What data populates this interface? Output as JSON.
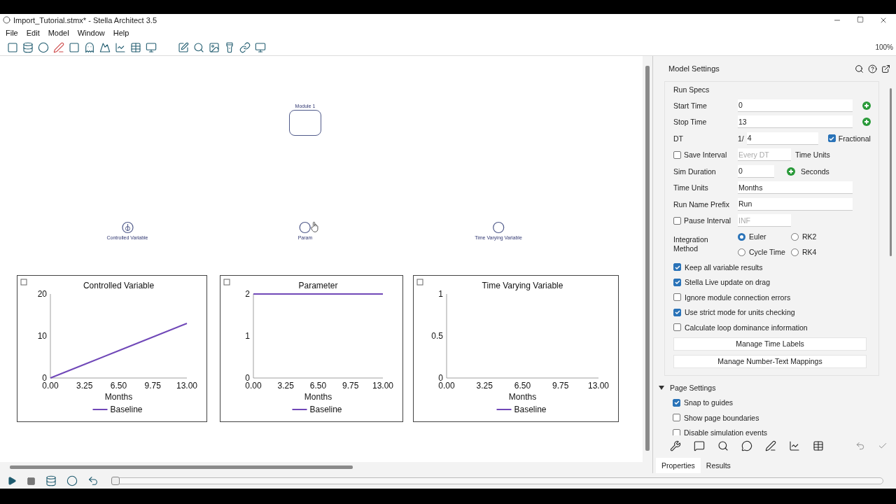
{
  "window": {
    "title": "Import_Tutorial.stmx* - Stella Architect 3.5"
  },
  "menu": [
    "File",
    "Edit",
    "Model",
    "Window",
    "Help"
  ],
  "toolbar": {
    "zoom": "100%"
  },
  "canvas": {
    "module": {
      "label": "Module 1"
    },
    "variables": [
      {
        "label": "Controlled Variable",
        "kind": "controlled"
      },
      {
        "label": "Param",
        "kind": "converter"
      },
      {
        "label": "Time Varying Variable",
        "kind": "converter"
      }
    ],
    "charts": [
      {
        "chart_data": {
          "type": "line",
          "title": "Controlled Variable",
          "xlabel": "Months",
          "categories": [
            "0.00",
            "3.25",
            "6.50",
            "9.75",
            "13.00"
          ],
          "ylim": [
            0,
            20
          ],
          "yticks": [
            0,
            10,
            20
          ],
          "series": [
            {
              "name": "Baseline",
              "color": "#7048b8",
              "values": [
                0,
                3.25,
                6.5,
                9.75,
                13
              ]
            }
          ]
        }
      },
      {
        "chart_data": {
          "type": "line",
          "title": "Parameter",
          "xlabel": "Months",
          "categories": [
            "0.00",
            "3.25",
            "6.50",
            "9.75",
            "13.00"
          ],
          "ylim": [
            0,
            2
          ],
          "yticks": [
            0,
            1,
            2
          ],
          "series": [
            {
              "name": "Baseline",
              "color": "#7048b8",
              "values": [
                2,
                2,
                2,
                2,
                2
              ]
            }
          ]
        }
      },
      {
        "chart_data": {
          "type": "line",
          "title": "Time Varying Variable",
          "xlabel": "Months",
          "categories": [
            "0.00",
            "3.25",
            "6.50",
            "9.75",
            "13.00"
          ],
          "ylim": [
            0,
            1
          ],
          "yticks": [
            0,
            0.5,
            1
          ],
          "series": [
            {
              "name": "Baseline",
              "color": "#7048b8",
              "values": [
                null,
                null,
                null,
                null,
                null
              ]
            }
          ]
        }
      }
    ]
  },
  "settings": {
    "title": "Model Settings",
    "run_specs": {
      "title": "Run Specs",
      "rows": [
        {
          "kind": "input",
          "label": "Start Time",
          "value": "0",
          "add": true
        },
        {
          "kind": "input",
          "label": "Stop Time",
          "value": "13",
          "add": true
        },
        {
          "kind": "dt",
          "label": "DT",
          "prefix": "1/",
          "value": "4",
          "option": {
            "label": "Fractional",
            "checked": true
          }
        },
        {
          "kind": "check-input",
          "label": "Save Interval",
          "checked": false,
          "placeholder": "Every DT",
          "unit": "Time Units"
        },
        {
          "kind": "unit-input",
          "label": "Sim Duration",
          "value": "0",
          "unit": "Seconds"
        },
        {
          "kind": "input",
          "label": "Time Units",
          "value": "Months",
          "add": false
        },
        {
          "kind": "input",
          "label": "Run Name Prefix",
          "value": "Run",
          "add": false
        },
        {
          "kind": "check-input",
          "label": "Pause Interval",
          "checked": false,
          "placeholder": "INF"
        },
        {
          "kind": "radio",
          "label": "Integration Method",
          "options": [
            {
              "label": "Euler",
              "selected": true
            },
            {
              "label": "RK2",
              "selected": false
            },
            {
              "label": "Cycle Time",
              "selected": false
            },
            {
              "label": "RK4",
              "selected": false
            }
          ]
        }
      ],
      "options": [
        {
          "label": "Keep all variable results",
          "checked": true
        },
        {
          "label": "Stella Live update on drag",
          "checked": true
        },
        {
          "label": "Ignore module connection errors",
          "checked": false
        },
        {
          "label": "Use strict mode for units checking",
          "checked": true
        },
        {
          "label": "Calculate loop dominance information",
          "checked": false
        }
      ],
      "buttons": [
        "Manage Time Labels",
        "Manage Number-Text Mappings"
      ]
    },
    "page_settings": {
      "title": "Page Settings",
      "expanded": true,
      "options": [
        {
          "label": "Snap to guides",
          "checked": true
        },
        {
          "label": "Show page boundaries",
          "checked": false
        },
        {
          "label": "Disable simulation events",
          "checked": false
        }
      ]
    },
    "tabs": [
      {
        "label": "Properties",
        "selected": true
      },
      {
        "label": "Results",
        "selected": false
      }
    ]
  },
  "run_bar": {
    "time_slider": {
      "level": 0
    }
  }
}
